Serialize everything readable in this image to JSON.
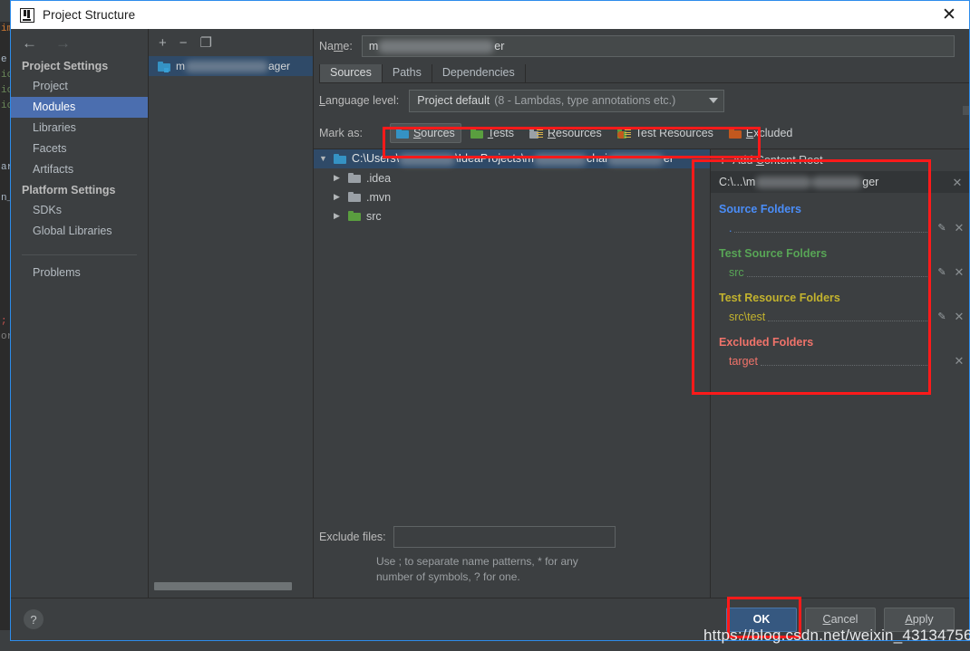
{
  "window": {
    "title": "Project Structure",
    "logo_icon": "intellij-idea-logo",
    "close_icon": "✕"
  },
  "sidebar": {
    "back_icon": "←",
    "forward_icon": "→",
    "groups": [
      {
        "title": "Project Settings",
        "items": [
          "Project",
          "Modules",
          "Libraries",
          "Facets",
          "Artifacts"
        ]
      },
      {
        "title": "Platform Settings",
        "items": [
          "SDKs",
          "Global Libraries"
        ]
      }
    ],
    "selected": "Modules",
    "problems_label": "Problems"
  },
  "modules_panel": {
    "add_icon": "+",
    "remove_icon": "−",
    "copy_icon": "❐",
    "module": {
      "prefix": "m",
      "suffix": "ager",
      "icon": "module-folder-icon"
    }
  },
  "main": {
    "name_label": "Name:",
    "name_label_underline": "m",
    "name_value_prefix": "m",
    "name_value_suffix": "er",
    "tabs": [
      {
        "label": "Sources",
        "active": true
      },
      {
        "label": "Paths",
        "active": false
      },
      {
        "label": "Dependencies",
        "active": false
      }
    ],
    "language_level": {
      "label": "Language level:",
      "label_underline": "L",
      "value": "Project default",
      "value_hint": "(8 - Lambdas, type annotations etc.)",
      "caret_icon": "chevron-down-icon"
    },
    "mark_as": {
      "label": "Mark as:",
      "buttons": [
        {
          "label": "Sources",
          "mnemonic": "S",
          "rest": "ources",
          "icon": "folder-blue-icon",
          "active": true
        },
        {
          "label": "Tests",
          "mnemonic": "T",
          "rest": "ests",
          "icon": "folder-green-icon",
          "active": false
        },
        {
          "label": "Resources",
          "mnemonic": "R",
          "rest": "esources",
          "icon": "resources-grey-icon",
          "active": false
        },
        {
          "label": "Test Resources",
          "mnemonic": "",
          "rest": "Test Resources",
          "icon": "test-resources-icon",
          "active": false
        },
        {
          "label": "Excluded",
          "mnemonic": "E",
          "rest": "xcluded",
          "icon": "folder-orange-icon",
          "active": false
        }
      ]
    },
    "tree": {
      "root": {
        "path_prefix": "C:\\Users\\",
        "path_mid": "\\IdeaProjects\\m",
        "path_mid2": "chai",
        "path_suffix": "er",
        "twisty": "▼",
        "icon": "folder-blue-icon"
      },
      "children": [
        {
          "label": ".idea",
          "icon": "folder-grey-icon",
          "twisty": "▶"
        },
        {
          "label": ".mvn",
          "icon": "folder-grey-icon",
          "twisty": "▶"
        },
        {
          "label": "src",
          "icon": "folder-green-icon",
          "twisty": "▶"
        }
      ]
    },
    "exclude": {
      "label": "Exclude files:",
      "value": "",
      "hint": "Use ; to separate name patterns, * for any number of symbols, ? for one."
    }
  },
  "right_panel": {
    "add_content_root": {
      "plus": "+",
      "label_pre": "Add ",
      "mnemonic": "C",
      "label_post": "ontent Root"
    },
    "content_root": {
      "path_prefix": "C:\\...\\m",
      "path_suffix": "ger",
      "remove_icon": "✕"
    },
    "sections": [
      {
        "title": "Source Folders",
        "color": "#4a8df8",
        "style": "blue",
        "entries": [
          {
            "path": ".",
            "has_pencil": true,
            "has_x": true
          }
        ]
      },
      {
        "title": "Test Source Folders",
        "color": "#58a556",
        "style": "green",
        "entries": [
          {
            "path": "src",
            "has_pencil": true,
            "has_x": true
          }
        ]
      },
      {
        "title": "Test Resource Folders",
        "color": "#c3b32e",
        "style": "yellow",
        "entries": [
          {
            "path": "src\\test",
            "has_pencil": true,
            "has_x": true
          }
        ]
      },
      {
        "title": "Excluded Folders",
        "color": "#f0736a",
        "style": "red",
        "entries": [
          {
            "path": "target",
            "has_pencil": false,
            "has_x": true
          }
        ]
      }
    ]
  },
  "footer": {
    "help_icon": "?",
    "buttons": [
      {
        "label": "OK",
        "mnemonic": "",
        "primary": true
      },
      {
        "label": "Cancel",
        "mnemonic": "C",
        "primary": false
      },
      {
        "label": "Apply",
        "mnemonic": "A",
        "primary": false
      }
    ]
  },
  "watermark": "https://blog.csdn.net/weixin_43134756",
  "annotations": {
    "highlight_color": "#ff1a1a",
    "boxes": [
      "mark-as-toolbar",
      "right-content-roots-panel",
      "ok-button"
    ]
  },
  "background_editor_lines": [
    "im",
    "",
    "e",
    "ic",
    "ic",
    "ic",
    "",
    "",
    "",
    "ar",
    "",
    "n_",
    "",
    "",
    "",
    "",
    "",
    "",
    "",
    "",
    ";",
    "or"
  ]
}
